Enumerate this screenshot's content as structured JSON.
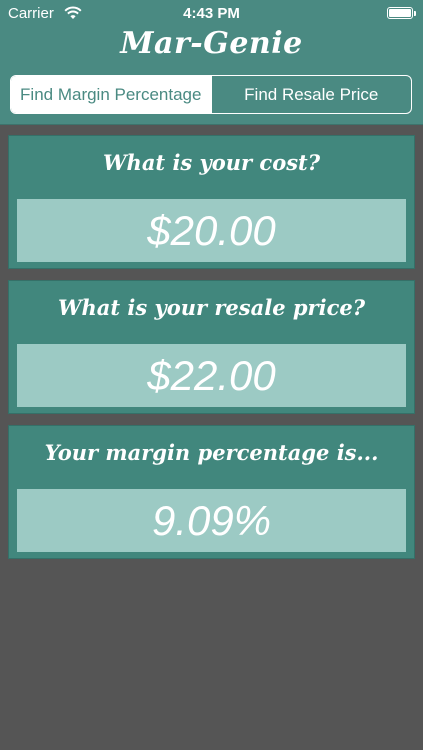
{
  "status_bar": {
    "carrier": "Carrier",
    "time": "4:43 PM"
  },
  "app": {
    "title": "Mar-Genie"
  },
  "mode_tabs": [
    {
      "label": "Find Margin Percentage",
      "selected": true
    },
    {
      "label": "Find Resale Price",
      "selected": false
    }
  ],
  "cost": {
    "question": "What is your cost?",
    "value": "$20.00"
  },
  "resale": {
    "question": "What is your resale price?",
    "value": "$22.00"
  },
  "result": {
    "label": "Your margin percentage is...",
    "value": "9.09%"
  },
  "colors": {
    "header": "#4a8a82",
    "card": "#41877d",
    "field": "#9ccac4",
    "background": "#555555"
  }
}
